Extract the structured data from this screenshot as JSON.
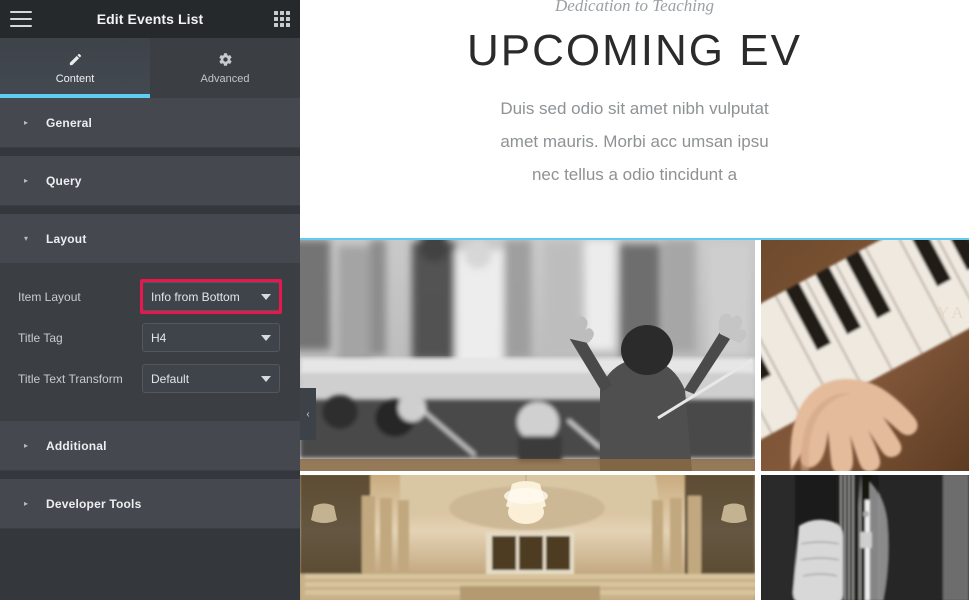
{
  "panel": {
    "header": {
      "title": "Edit Events List",
      "menu_icon": "hamburger-icon",
      "apps_icon": "grid-apps-icon"
    },
    "tabs": [
      {
        "label": "Content",
        "icon": "pencil-icon",
        "active": true
      },
      {
        "label": "Advanced",
        "icon": "gear-icon",
        "active": false
      }
    ],
    "sections": [
      {
        "label": "General",
        "expanded": false
      },
      {
        "label": "Query",
        "expanded": false
      },
      {
        "label": "Layout",
        "expanded": true
      },
      {
        "label": "Additional",
        "expanded": false
      },
      {
        "label": "Developer Tools",
        "expanded": false
      }
    ],
    "layout_controls": [
      {
        "label": "Item Layout",
        "value": "Info from Bottom",
        "highlighted": true
      },
      {
        "label": "Title Tag",
        "value": "H4",
        "highlighted": false
      },
      {
        "label": "Title Text Transform",
        "value": "Default",
        "highlighted": false
      }
    ],
    "collapse_handle": "‹",
    "colors": {
      "accent": "#5ecdf0",
      "highlight": "#e8174d",
      "panel_bg": "#34383c",
      "section_bg": "#45494f",
      "header_bg": "#26292c"
    }
  },
  "preview": {
    "eyebrow": "Dedication to Teaching",
    "title": "UPCOMING EV",
    "paragraph_lines": [
      "Duis sed odio sit amet nibh vulputat",
      "amet mauris. Morbi acc umsan ipsu",
      "nec tellus a odio tincidunt a"
    ],
    "events": [
      {
        "name": "conductor-orchestra-photo",
        "alt": "Conductor with raised arms in front of orchestra"
      },
      {
        "name": "piano-hand-photo",
        "alt": "Hand playing wooden Yamaha piano keys"
      },
      {
        "name": "concert-hall-photo",
        "alt": "Interior of a concert hall with chandelier"
      },
      {
        "name": "violin-bow-photo",
        "alt": "Hand holding violin neck and bow"
      }
    ]
  }
}
